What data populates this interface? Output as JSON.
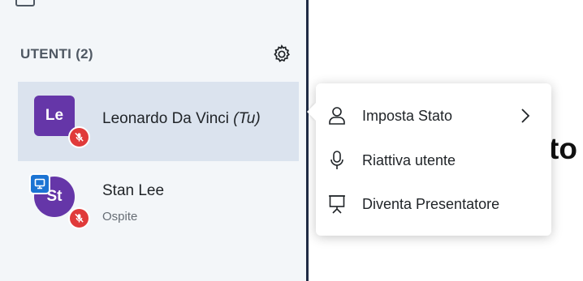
{
  "sidebar": {
    "users_title": "UTENTI (2)",
    "users": [
      {
        "initials": "Le",
        "name": "Leonardo Da Vinci",
        "you_tag": "(Tu)",
        "role": "",
        "avatar_color": "#6536a8",
        "muted": true,
        "presenter": false,
        "selected": true
      },
      {
        "initials": "St",
        "name": "Stan Lee",
        "role": "Ospite",
        "avatar_color": "#6536a8",
        "muted": true,
        "presenter": true,
        "selected": false
      }
    ]
  },
  "context_menu": {
    "items": [
      {
        "label": "Imposta Stato",
        "icon": "user-status-icon",
        "has_submenu": true
      },
      {
        "label": "Riattiva utente",
        "icon": "microphone-icon",
        "has_submenu": false
      },
      {
        "label": "Diventa Presentatore",
        "icon": "presentation-icon",
        "has_submenu": false
      }
    ]
  },
  "background": {
    "text_fragment": "to"
  },
  "colors": {
    "accent": "#6536a8",
    "muted_badge": "#e03a3a",
    "presenter_badge": "#1b74d3",
    "selected_row": "#dbe3ee",
    "sidebar_bg": "#f3f6f9",
    "sidebar_border": "#1f2b45"
  }
}
